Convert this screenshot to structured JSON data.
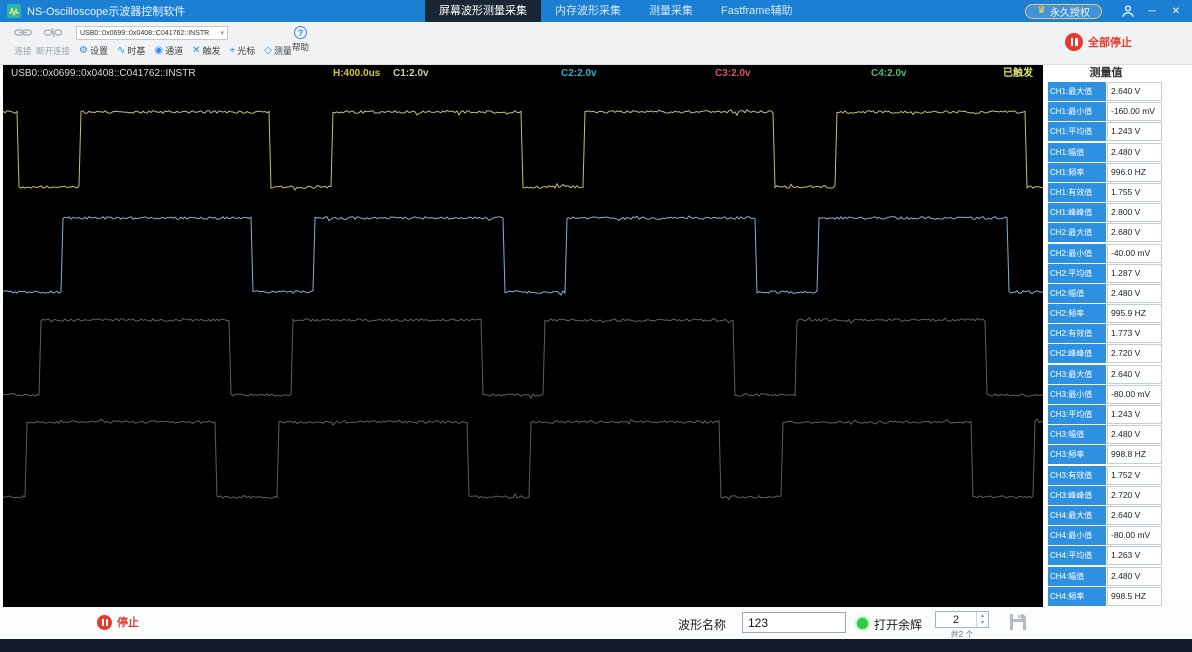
{
  "colors": {
    "titlebar": "#1b7fd4",
    "tab_active_bg": "#1a2634",
    "accent": "#2d8cf0",
    "stop_red": "#e8392e",
    "timebase_yellow": "#d6c62e",
    "trigger_yellow": "#e3e370",
    "panel_label_blue": "#2e90e0",
    "persist_green": "#2ecc40"
  },
  "window": {
    "title": "NS-Oscilloscope示波器控制软件",
    "license_badge": "永久授权",
    "tabs": [
      {
        "label": "屏幕波形测量采集",
        "active": true
      },
      {
        "label": "内存波形采集",
        "active": false
      },
      {
        "label": "测量采集",
        "active": false
      },
      {
        "label": "Fastframe辅助",
        "active": false
      }
    ]
  },
  "toolbar": {
    "connect": "连接",
    "disconnect": "断开连接",
    "device": "USB0::0x0699::0x0408::C041762::INSTR",
    "buttons": [
      {
        "label": "设置",
        "icon": "gear"
      },
      {
        "label": "时基",
        "icon": "timebase-wave"
      },
      {
        "label": "通道",
        "icon": "channel-dot"
      },
      {
        "label": "触发",
        "icon": "trigger-cross"
      },
      {
        "label": "光标",
        "icon": "cursor-target"
      },
      {
        "label": "测量",
        "icon": "measure-diamond"
      }
    ],
    "help": "帮助",
    "stop_all": "全部停止"
  },
  "scope": {
    "resource": "USB0::0x0699::0x0408::C041762::INSTR",
    "timebase": "H:400.0us",
    "trigger_status": "已触发",
    "channel_labels": [
      {
        "label": "C1:2.0v",
        "color": "#cfcf9e"
      },
      {
        "label": "C2:2.0v",
        "color": "#21b6d4"
      },
      {
        "label": "C3:2.0v",
        "color": "#e0506a"
      },
      {
        "label": "C4:2.0v",
        "color": "#4fbf6f"
      }
    ]
  },
  "measurements": {
    "header": "测量值",
    "rows": [
      {
        "label": "CH1:最大值",
        "value": "2.640 V"
      },
      {
        "label": "CH1:最小值",
        "value": "-160.00 mV"
      },
      {
        "label": "CH1:平均值",
        "value": "1.243 V"
      },
      {
        "label": "CH1:幅值",
        "value": "2.480 V"
      },
      {
        "label": "CH1:频率",
        "value": "996.0 HZ"
      },
      {
        "label": "CH1:有效值",
        "value": "1.755 V"
      },
      {
        "label": "CH1:峰峰值",
        "value": "2.800 V"
      },
      {
        "label": "CH2:最大值",
        "value": "2.680 V"
      },
      {
        "label": "CH2:最小值",
        "value": "-40.00 mV"
      },
      {
        "label": "CH2:平均值",
        "value": "1.287 V"
      },
      {
        "label": "CH2:幅值",
        "value": "2.480 V"
      },
      {
        "label": "CH2:频率",
        "value": "995.9 HZ"
      },
      {
        "label": "CH2:有效值",
        "value": "1.773 V"
      },
      {
        "label": "CH2:峰峰值",
        "value": "2.720 V"
      },
      {
        "label": "CH3:最大值",
        "value": "2.640 V"
      },
      {
        "label": "CH3:最小值",
        "value": "-80.00 mV"
      },
      {
        "label": "CH3:平均值",
        "value": "1.243 V"
      },
      {
        "label": "CH3:幅值",
        "value": "2.480 V"
      },
      {
        "label": "CH3:频率",
        "value": "998.8 HZ"
      },
      {
        "label": "CH3:有效值",
        "value": "1.752 V"
      },
      {
        "label": "CH3:峰峰值",
        "value": "2.720 V"
      },
      {
        "label": "CH4:最大值",
        "value": "2.640 V"
      },
      {
        "label": "CH4:最小值",
        "value": "-80.00 mV"
      },
      {
        "label": "CH4:平均值",
        "value": "1.263 V"
      },
      {
        "label": "CH4:幅值",
        "value": "2.480 V"
      },
      {
        "label": "CH4:频率",
        "value": "998.5 HZ"
      }
    ]
  },
  "footer": {
    "stop": "停止",
    "waveform_name_label": "波形名称",
    "waveform_name_value": "123",
    "persist_label": "打开余辉",
    "count_value": "2",
    "count_caption": "共2 个"
  },
  "chart_data": {
    "type": "line",
    "title": "4-channel oscilloscope square waveforms",
    "timebase_per_div": "400.0us",
    "trigger_status": "已触发",
    "channels": [
      {
        "name": "CH1",
        "color": "#c6c06a",
        "scale": "2.0v/div",
        "shape": "square",
        "freq_hz": 996.0,
        "max_v": 2.64,
        "min_v": -0.16,
        "amplitude_v": 2.48,
        "mean_v": 1.243,
        "rms_v": 1.755,
        "pkpk_v": 2.8
      },
      {
        "name": "CH2",
        "color": "#7db3d6",
        "scale": "2.0v/div",
        "shape": "square",
        "freq_hz": 995.9,
        "max_v": 2.68,
        "min_v": -0.04,
        "amplitude_v": 2.48,
        "mean_v": 1.287,
        "rms_v": 1.773,
        "pkpk_v": 2.72
      },
      {
        "name": "CH3",
        "color": "#606060",
        "scale": "2.0v/div",
        "shape": "square",
        "freq_hz": 998.8,
        "max_v": 2.64,
        "min_v": -0.08,
        "amplitude_v": 2.48,
        "mean_v": 1.243,
        "rms_v": 1.752,
        "pkpk_v": 2.72
      },
      {
        "name": "CH4",
        "color": "#5a615a",
        "scale": "2.0v/div",
        "shape": "square",
        "freq_hz": 998.5,
        "max_v": 2.64,
        "min_v": -0.08,
        "amplitude_v": 2.48,
        "mean_v": 1.263
      }
    ]
  }
}
